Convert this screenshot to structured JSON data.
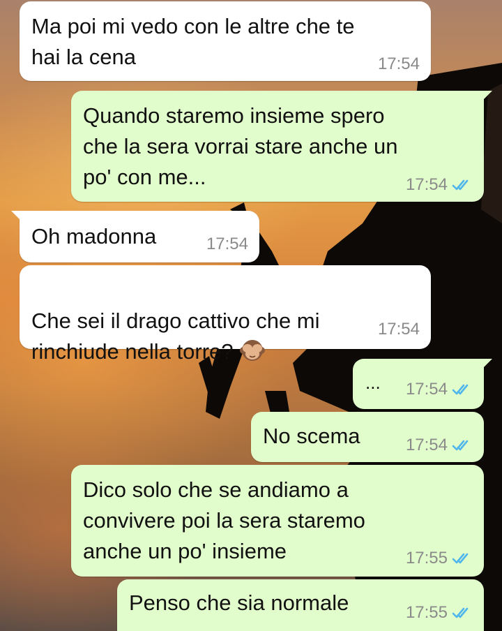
{
  "chat": {
    "messages": [
      {
        "id": "m1",
        "direction": "incoming",
        "text": "Ma poi mi vedo con le altre che te\nhai la cena",
        "time": "17:54"
      },
      {
        "id": "m2",
        "direction": "outgoing",
        "text": "Quando staremo insieme spero\nche la sera vorrai stare anche un\npo' con me...",
        "time": "17:54",
        "status": "read"
      },
      {
        "id": "m3",
        "direction": "incoming",
        "text": "Oh madonna",
        "time": "17:54"
      },
      {
        "id": "m4",
        "direction": "incoming",
        "text": "Che sei il drago cattivo che mi\nrinchiude nella torre?",
        "emoji": "see-no-evil-monkey-icon",
        "time": "17:54"
      },
      {
        "id": "m5",
        "direction": "outgoing",
        "text": "...",
        "time": "17:54",
        "status": "read"
      },
      {
        "id": "m6",
        "direction": "outgoing",
        "text": "No scema",
        "time": "17:54",
        "status": "read"
      },
      {
        "id": "m7",
        "direction": "outgoing",
        "text": "Dico solo che se andiamo a\nconvivere poi la sera staremo\nanche un po' insieme",
        "time": "17:55",
        "status": "read"
      },
      {
        "id": "m8",
        "direction": "outgoing",
        "text": "Penso che sia normale",
        "time": "17:55",
        "status": "read"
      }
    ]
  },
  "colors": {
    "incoming_bubble": "#ffffff",
    "outgoing_bubble": "#e2fdcc",
    "read_ticks": "#4fb6ec",
    "timestamp": "#8a8a8a"
  }
}
